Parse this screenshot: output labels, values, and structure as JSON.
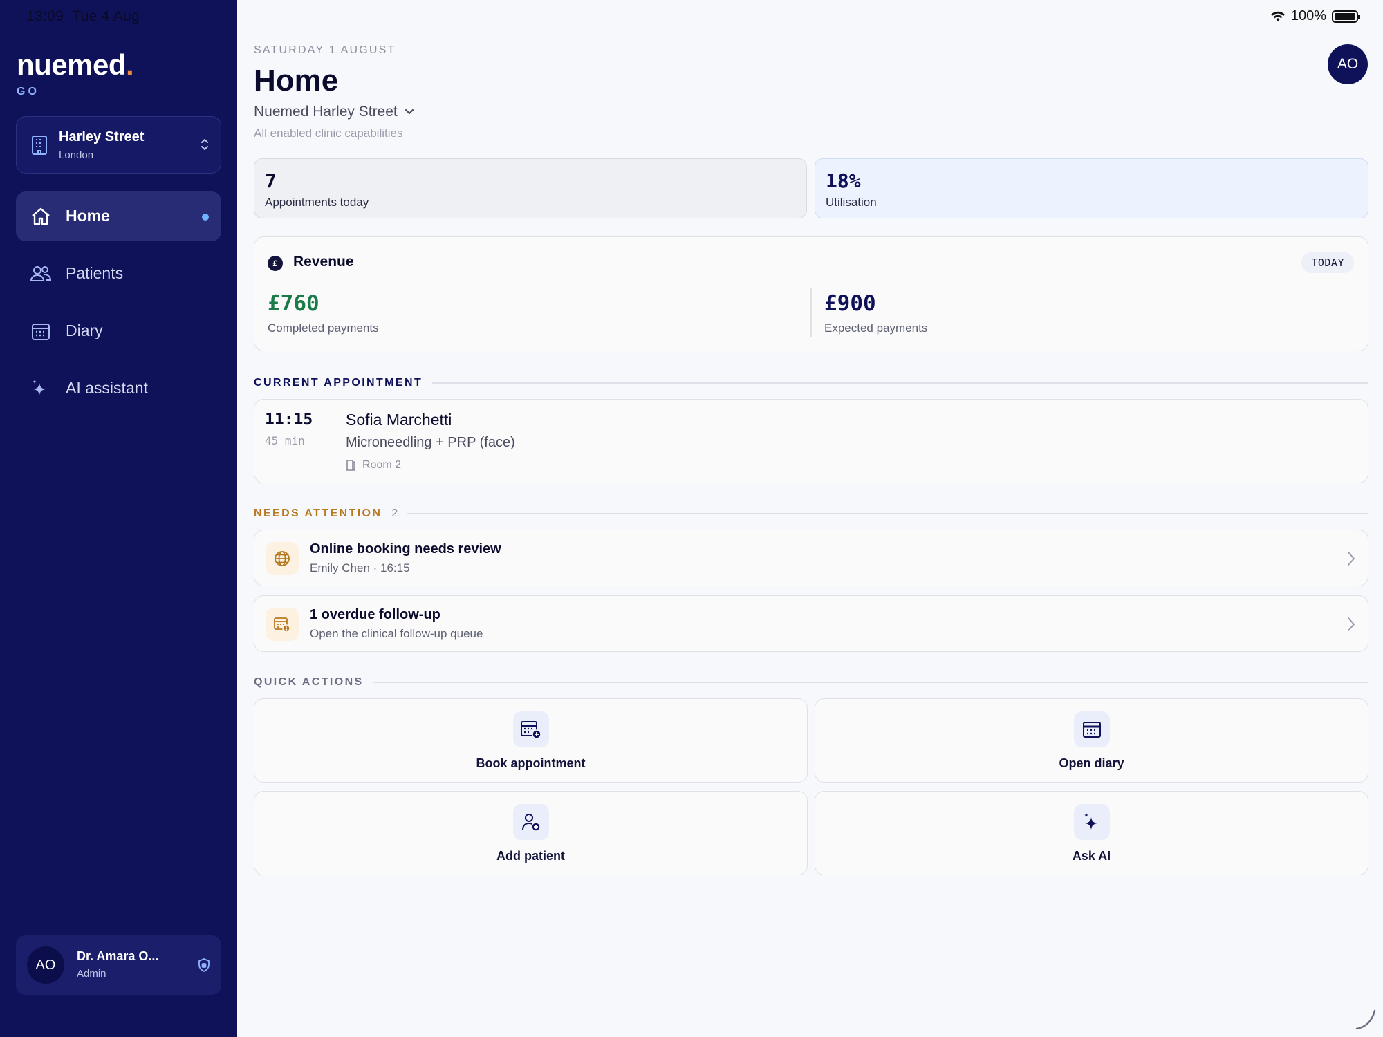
{
  "status_bar": {
    "time": "13:09",
    "date": "Tue 4 Aug",
    "battery": "100%"
  },
  "brand": {
    "name": "nuemed",
    "dot": ".",
    "sub": "GO"
  },
  "clinic_switcher": {
    "name": "Harley Street",
    "city": "London"
  },
  "nav": [
    {
      "label": "Home",
      "icon": "home-icon",
      "active": true
    },
    {
      "label": "Patients",
      "icon": "patients-icon"
    },
    {
      "label": "Diary",
      "icon": "calendar-icon"
    },
    {
      "label": "AI assistant",
      "icon": "sparkle-icon"
    }
  ],
  "user": {
    "initials": "AO",
    "name": "Dr. Amara O...",
    "role": "Admin"
  },
  "header": {
    "date": "SATURDAY 1 AUGUST",
    "title": "Home",
    "location": "Nuemed Harley Street",
    "subtitle": "All enabled clinic capabilities",
    "avatar_initials": "AO"
  },
  "stats": [
    {
      "value": "7",
      "label": "Appointments today"
    },
    {
      "value": "18%",
      "label": "Utilisation"
    }
  ],
  "revenue": {
    "title": "Revenue",
    "badge": "TODAY",
    "completed_amount": "£760",
    "completed_label": "Completed payments",
    "expected_amount": "£900",
    "expected_label": "Expected payments"
  },
  "current_appointment": {
    "heading": "CURRENT APPOINTMENT",
    "time": "11:15",
    "duration": "45 min",
    "patient": "Sofia Marchetti",
    "treatment": "Microneedling + PRP (face)",
    "room": "Room 2"
  },
  "needs_attention": {
    "heading": "NEEDS ATTENTION",
    "count": "2",
    "items": [
      {
        "title": "Online booking needs review",
        "subtitle": "Emily Chen · 16:15",
        "icon": "globe-icon"
      },
      {
        "title": "1 overdue follow-up",
        "subtitle": "Open the clinical follow-up queue",
        "icon": "calendar-alert-icon"
      }
    ]
  },
  "quick_actions": {
    "heading": "QUICK ACTIONS",
    "items": [
      {
        "label": "Book appointment",
        "icon": "calendar-plus-icon"
      },
      {
        "label": "Open diary",
        "icon": "calendar-icon"
      },
      {
        "label": "Add patient",
        "icon": "user-plus-icon"
      },
      {
        "label": "Ask AI",
        "icon": "sparkle-icon"
      }
    ]
  },
  "colors": {
    "sidebar": "#0f1259",
    "accent": "#0f1259",
    "brand_dot": "#f08a3c",
    "positive": "#1b7a4a",
    "attention": "#b7791f"
  }
}
